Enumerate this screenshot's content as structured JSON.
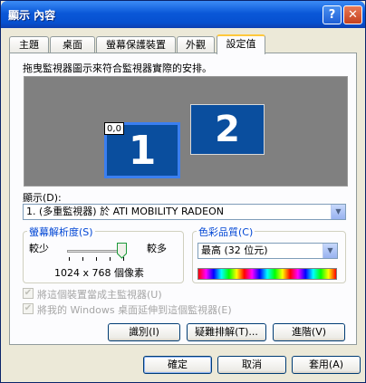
{
  "window": {
    "title": "顯示 內容",
    "help_label": "?",
    "close_label": "✕"
  },
  "tabs": [
    "主題",
    "桌面",
    "螢幕保護裝置",
    "外觀",
    "設定值"
  ],
  "instruction": "拖曳監視器圖示來符合監視器實際的安排。",
  "monitors": [
    {
      "label": "1",
      "coord": "0,0"
    },
    {
      "label": "2"
    }
  ],
  "display": {
    "label": "顯示(D):",
    "value": "1. (多重監視器) 於 ATI MOBILITY RADEON"
  },
  "resolution": {
    "title": "螢幕解析度(S)",
    "less": "較少",
    "more": "較多",
    "value_text": "1024 x 768 個像素",
    "slider_level": 1.0
  },
  "color_quality": {
    "title": "色彩品質(C)",
    "value": "最高 (32 位元)"
  },
  "checkboxes": [
    {
      "label": "將這個裝置當成主監視器(U)",
      "checked": true,
      "disabled": true
    },
    {
      "label": "將我的 Windows 桌面延伸到這個監視器(E)",
      "checked": true,
      "disabled": true
    }
  ],
  "panel_buttons": {
    "identify": "識別(I)",
    "troubleshoot": "疑難排解(T)...",
    "advanced": "進階(V)"
  },
  "dialog_buttons": {
    "ok": "確定",
    "cancel": "取消",
    "apply": "套用(A)"
  },
  "icons": {
    "dropdown": "chevron-down-icon",
    "cursor": "mouse-pointer-icon"
  },
  "colors": {
    "titlebar": "#0a58d8",
    "monitor": "#0a4e9e",
    "group_title": "#0046d5"
  }
}
